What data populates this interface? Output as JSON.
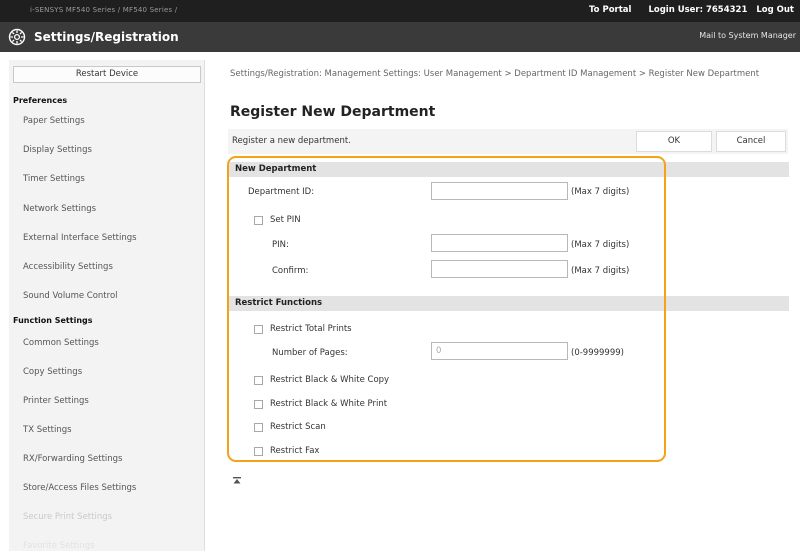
{
  "topbar": {
    "model": "i-SENSYS   MF540 Series / MF540 Series /",
    "portal": "To Portal",
    "login_user": "Login User:  7654321",
    "logout": "Log Out"
  },
  "header": {
    "title": "Settings/Registration",
    "mail": "Mail to System Manager",
    "logo_icon": "settings-gear-icon"
  },
  "sidebar": {
    "restart": "Restart Device",
    "preferences_label": "Preferences",
    "preferences": [
      "Paper Settings",
      "Display Settings",
      "Timer Settings",
      "Network Settings",
      "External Interface Settings",
      "Accessibility Settings",
      "Sound Volume Control"
    ],
    "function_label": "Function Settings",
    "functions": [
      "Common Settings",
      "Copy Settings",
      "Printer Settings",
      "TX Settings",
      "RX/Forwarding Settings",
      "Store/Access Files Settings",
      "Secure Print Settings",
      "Favorite Settings"
    ]
  },
  "main": {
    "breadcrumb": "Settings/Registration: Management Settings: User Management > Department ID Management > Register New Department",
    "title": "Register New Department",
    "description": "Register a new department.",
    "ok": "OK",
    "cancel": "Cancel",
    "new_dept": {
      "heading": "New Department",
      "dept_id_label": "Department ID:",
      "dept_id_value": "",
      "dept_id_hint": "(Max 7 digits)",
      "set_pin_label": "Set PIN",
      "pin_label": "PIN:",
      "pin_value": "",
      "pin_hint": "(Max 7 digits)",
      "confirm_label": "Confirm:",
      "confirm_value": "",
      "confirm_hint": "(Max 7 digits)"
    },
    "restrict": {
      "heading": "Restrict Functions",
      "total_prints_label": "Restrict Total Prints",
      "pages_label": "Number of Pages:",
      "pages_value": "0",
      "pages_hint": "(0-9999999)",
      "bw_copy_label": "Restrict Black & White Copy",
      "bw_print_label": "Restrict Black & White Print",
      "scan_label": "Restrict Scan",
      "fax_label": "Restrict Fax"
    },
    "back_to_top_icon": "back-to-top-icon",
    "highlight_color": "#f3a21a"
  }
}
